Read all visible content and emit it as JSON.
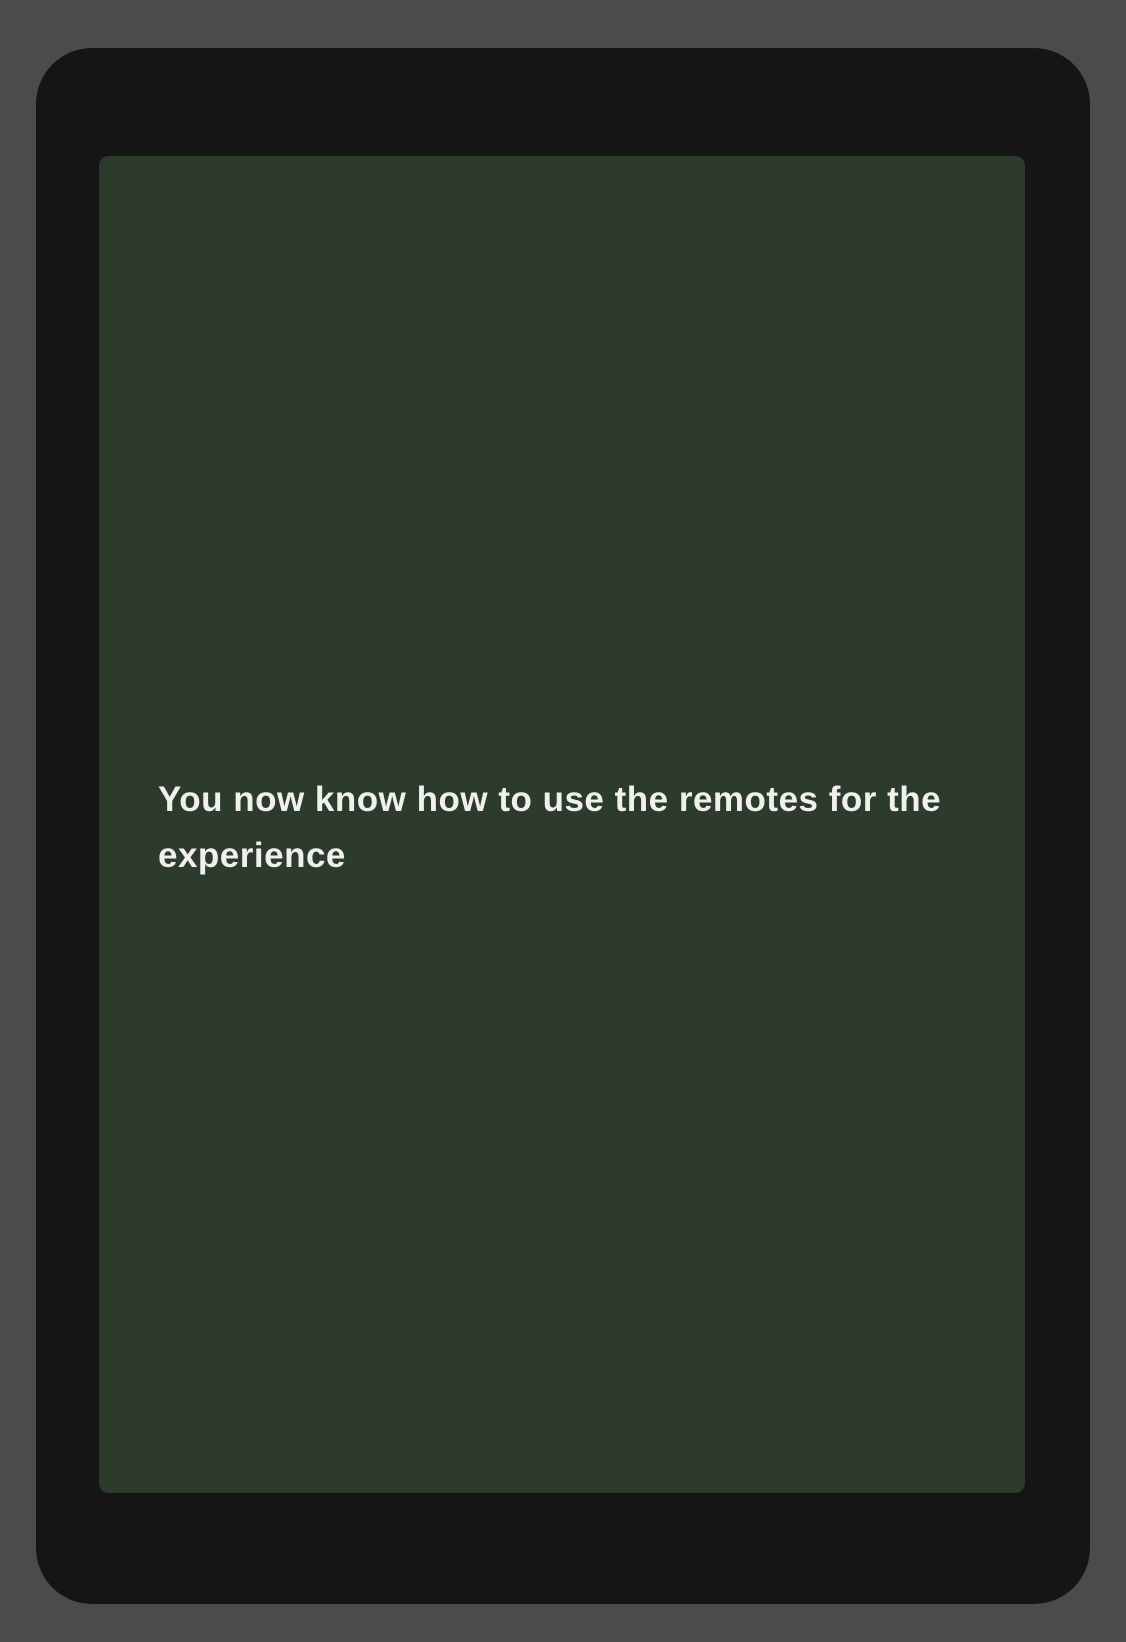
{
  "screen": {
    "message": "You now know how to use the remotes for the experience"
  },
  "colors": {
    "backdrop": "#4b4b4b",
    "device_frame": "#151515",
    "screen_background": "#2c3b2c",
    "text": "#f0f0ee"
  }
}
